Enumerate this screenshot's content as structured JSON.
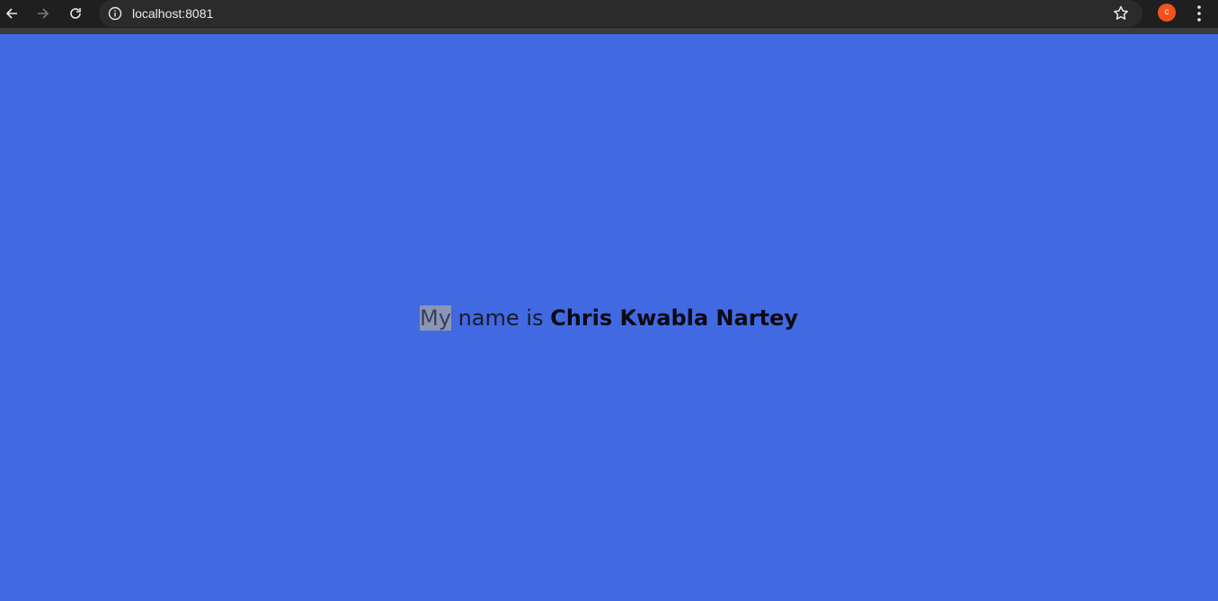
{
  "browser": {
    "url": "localhost:8081",
    "avatar_letter": "c",
    "icons": {
      "back": "arrow-left-icon",
      "forward": "arrow-right-icon",
      "reload": "reload-icon",
      "info": "info-icon",
      "bookmark": "star-icon",
      "menu": "kebab-menu-icon"
    },
    "colors": {
      "toolbar": "#1f1f1f",
      "omnibox": "#2b2b2b",
      "avatar": "#f4511e"
    }
  },
  "page": {
    "background": "#4169e1",
    "greeting": {
      "highlighted_word": "My",
      "middle": " name is ",
      "name": "Chris Kwabla Nartey"
    }
  }
}
